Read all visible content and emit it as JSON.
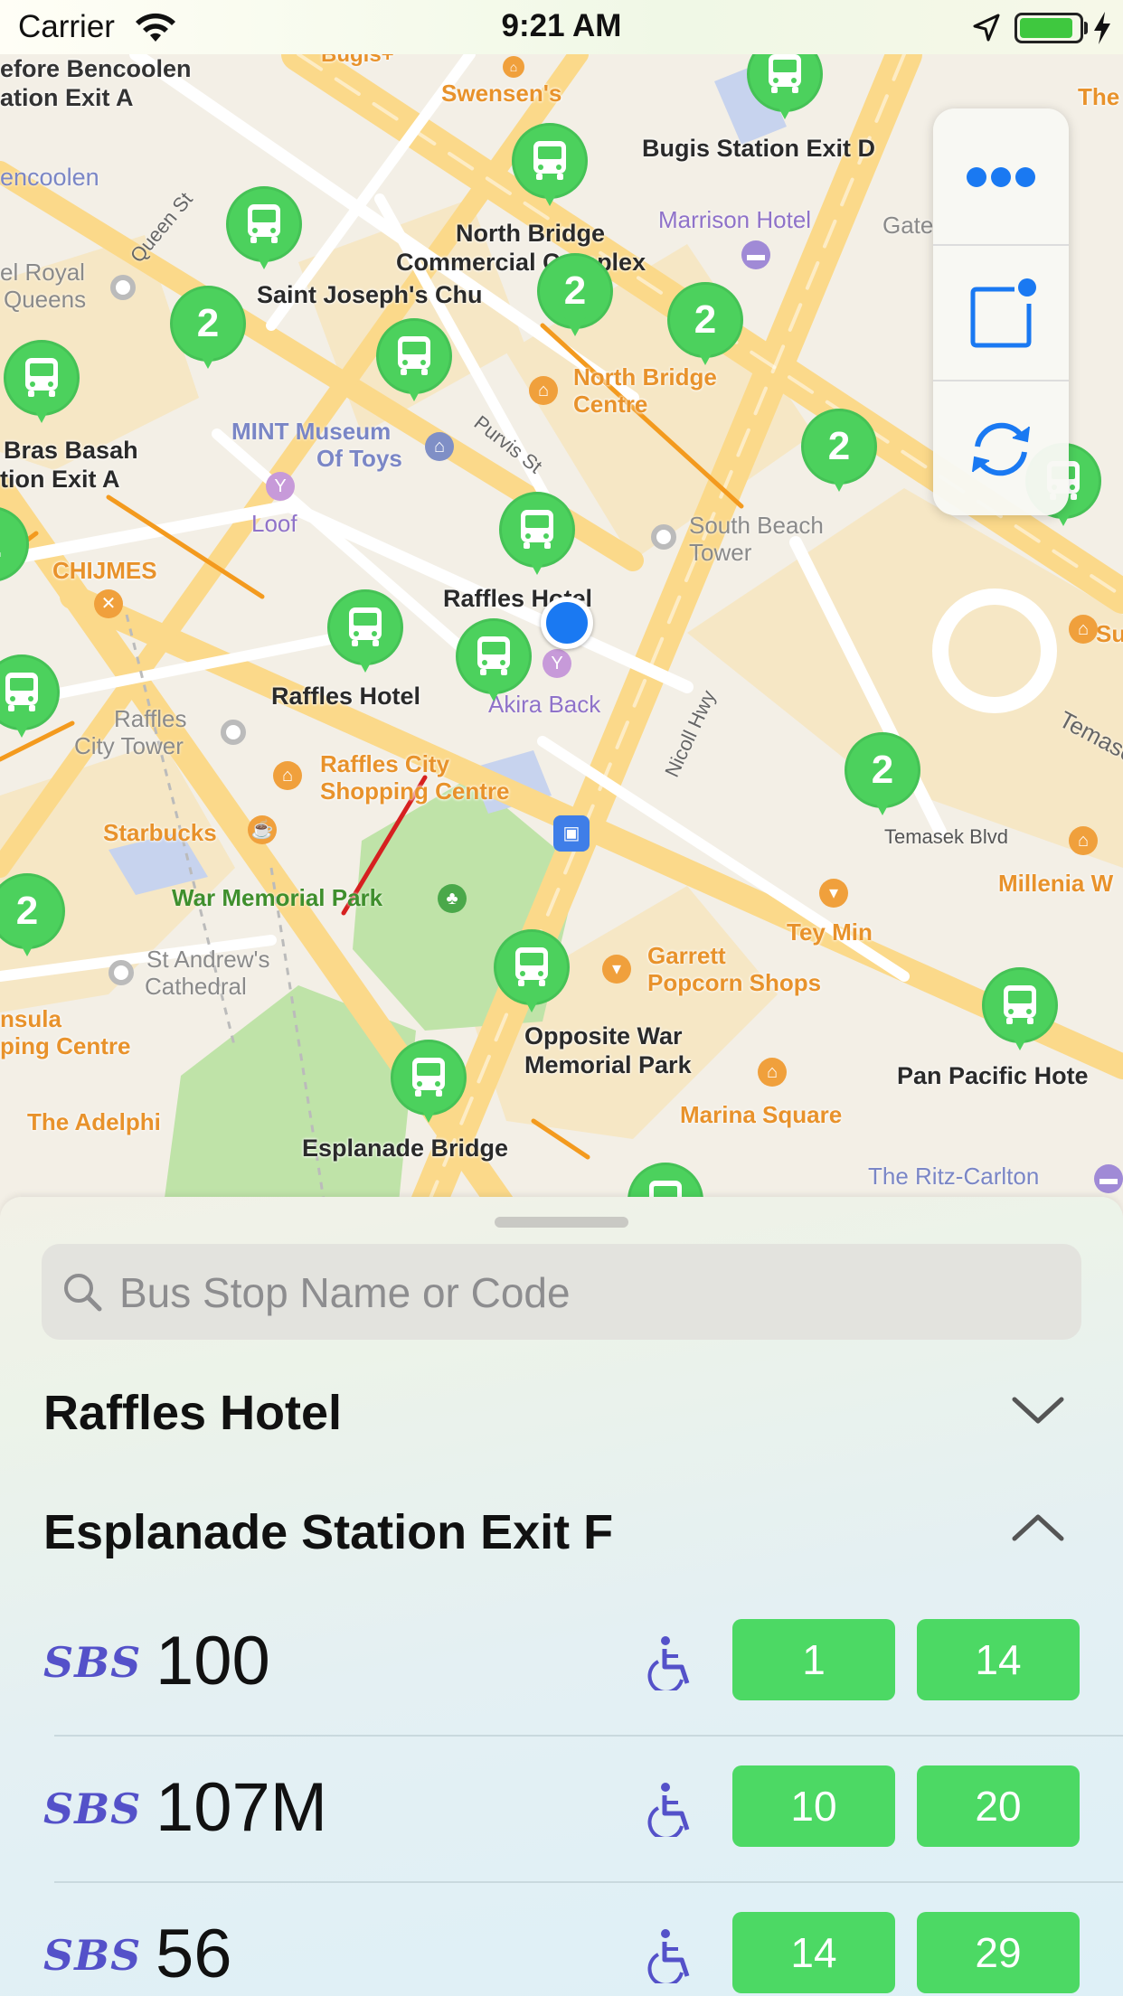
{
  "status_bar": {
    "carrier": "Carrier",
    "time": "9:21 AM",
    "battery_level": 1.0
  },
  "map": {
    "street_labels": {
      "before_bencoolen": "efore Bencoolen",
      "station_exit_a": "ation Exit A",
      "bugis_station_exit_d": "Bugis Station Exit D",
      "north_bridge_commercial_1": "North Bridge",
      "north_bridge_commercial_2": "Commercial Complex",
      "saint_josephs": "Saint Joseph's Chu",
      "bras_basah_1": "Bras Basah",
      "bras_basah_2": "tion Exit A",
      "raffles_hotel_1": "Raffles Hotel",
      "raffles_hotel_2": "Raffles Hotel",
      "opposite_war_1": "Opposite War",
      "opposite_war_2": "Memorial Park",
      "pan_pacific": "Pan Pacific Hote",
      "esplanade_bridge": "Esplanade Bridge"
    },
    "poi_labels": {
      "bugis_plus": "Bugis+",
      "swensens": "Swensen's",
      "the": "The",
      "encoolen": "encoolen",
      "el_royal_1": "el Royal",
      "el_royal_2": "Queens",
      "marrison_hotel": "Marrison Hotel",
      "gate": "Gate",
      "north_bridge_centre_1": "North Bridge",
      "north_bridge_centre_2": "Centre",
      "mint_museum_1": "MINT Museum",
      "mint_museum_2": "Of Toys",
      "loof": "Loof",
      "chijmes": "CHIJMES",
      "south_beach_tower_1": "South Beach",
      "south_beach_tower_2": "Tower",
      "akira_back": "Akira Back",
      "raffles_city_tower_1": "Raffles",
      "raffles_city_tower_2": "City Tower",
      "raffles_city_shopping_1": "Raffles City",
      "raffles_city_shopping_2": "Shopping Centre",
      "starbucks": "Starbucks",
      "war_memorial_park": "War Memorial Park",
      "st_andrews_1": "St Andrew's",
      "st_andrews_2": "Cathedral",
      "peninsula_1": "nsula",
      "peninsula_2": "ping Centre",
      "the_adelphi": "The Adelphi",
      "garrett_1": "Garrett",
      "garrett_2": "Popcorn Shops",
      "tey_min": "Tey Min",
      "marina_square": "Marina Square",
      "millenia": "Millenia W",
      "the_ritz_carlton": "The Ritz-Carlton",
      "su": "Su",
      "temasek_tail": "Temase"
    },
    "road_labels": {
      "queen_st": "Queen St",
      "purvis_st": "Purvis St",
      "nicoll_hwy": "Nicoll Hwy",
      "temasek_blvd": "Temasek Blvd"
    },
    "cluster_count": "2"
  },
  "controls": [
    {
      "name": "more-button",
      "icon": "ellipsis-icon"
    },
    {
      "name": "notification-button",
      "icon": "badge-square-icon"
    },
    {
      "name": "refresh-button",
      "icon": "refresh-icon"
    }
  ],
  "sheet": {
    "search": {
      "placeholder": "Bus Stop Name or Code",
      "value": ""
    },
    "sections": [
      {
        "title": "Raffles Hotel",
        "expanded": false
      },
      {
        "title": "Esplanade Station Exit F",
        "expanded": true
      }
    ],
    "services": [
      {
        "operator": "SBS",
        "service": "100",
        "wheelchair": true,
        "eta1": "1",
        "eta2": "14"
      },
      {
        "operator": "SBS",
        "service": "107M",
        "wheelchair": true,
        "eta1": "10",
        "eta2": "20"
      },
      {
        "operator": "SBS",
        "service": "56",
        "wheelchair": true,
        "eta1": "14",
        "eta2": "29"
      }
    ]
  },
  "colors": {
    "accent_green": "#4cd964",
    "pin_green": "#4cd15d",
    "operator_purple": "#5451c9",
    "control_blue": "#1a79f2"
  }
}
